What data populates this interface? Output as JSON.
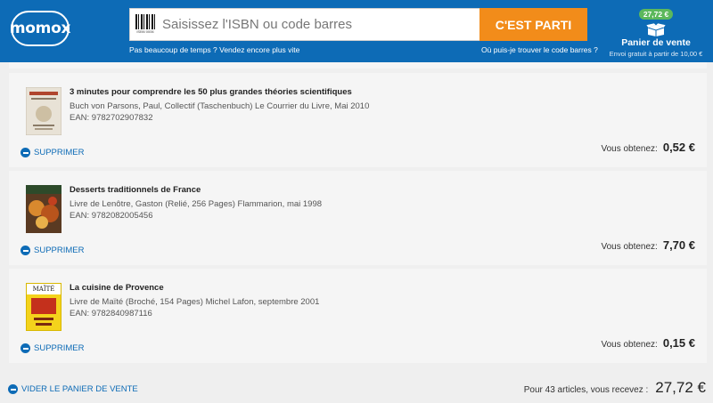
{
  "header": {
    "logo": "momox",
    "search": {
      "placeholder": "Saisissez l'ISBN ou code barres",
      "barcode_label": "ISBN 0006",
      "button": "C'EST PARTI"
    },
    "hint_left": "Pas beaucoup de temps ? Vendez encore plus vite",
    "hint_right": "Où puis-je trouver le code barres ?",
    "cart": {
      "badge": "27,72 €",
      "title": "Panier de vente",
      "subtitle": "Envoi gratuit à partir de 10,00 €",
      "icon": "box-icon"
    }
  },
  "items": [
    {
      "title": "3 minutes pour comprendre les 50 plus grandes théories scientifiques",
      "details": "Buch von Parsons, Paul, Collectif (Taschenbuch) Le Courrier du Livre, Mai 2010",
      "ean": "EAN: 9782702907832",
      "remove": "SUPPRIMER",
      "price_label": "Vous obtenez:",
      "price": "0,52 €"
    },
    {
      "title": "Desserts traditionnels de France",
      "details": "Livre de Lenôtre, Gaston (Relié, 256 Pages) Flammarion, mai 1998",
      "ean": "EAN: 9782082005456",
      "remove": "SUPPRIMER",
      "price_label": "Vous obtenez:",
      "price": "7,70 €"
    },
    {
      "title": "La cuisine de Provence",
      "details": "Livre de Maïté (Broché, 154 Pages) Michel Lafon, septembre 2001",
      "ean": "EAN: 9782840987116",
      "remove": "SUPPRIMER",
      "price_label": "Vous obtenez:",
      "price": "0,15 €",
      "cover_text": "MAÏTÉ"
    }
  ],
  "footer": {
    "empty_cart": "VIDER LE PANIER DE VENTE",
    "total_label": "Pour 43 articles, vous recevez :",
    "total": "27,72 €"
  },
  "colors": {
    "brand_blue": "#0d6bb6",
    "cta_orange": "#f28c1a",
    "badge_green": "#5cb85c"
  }
}
